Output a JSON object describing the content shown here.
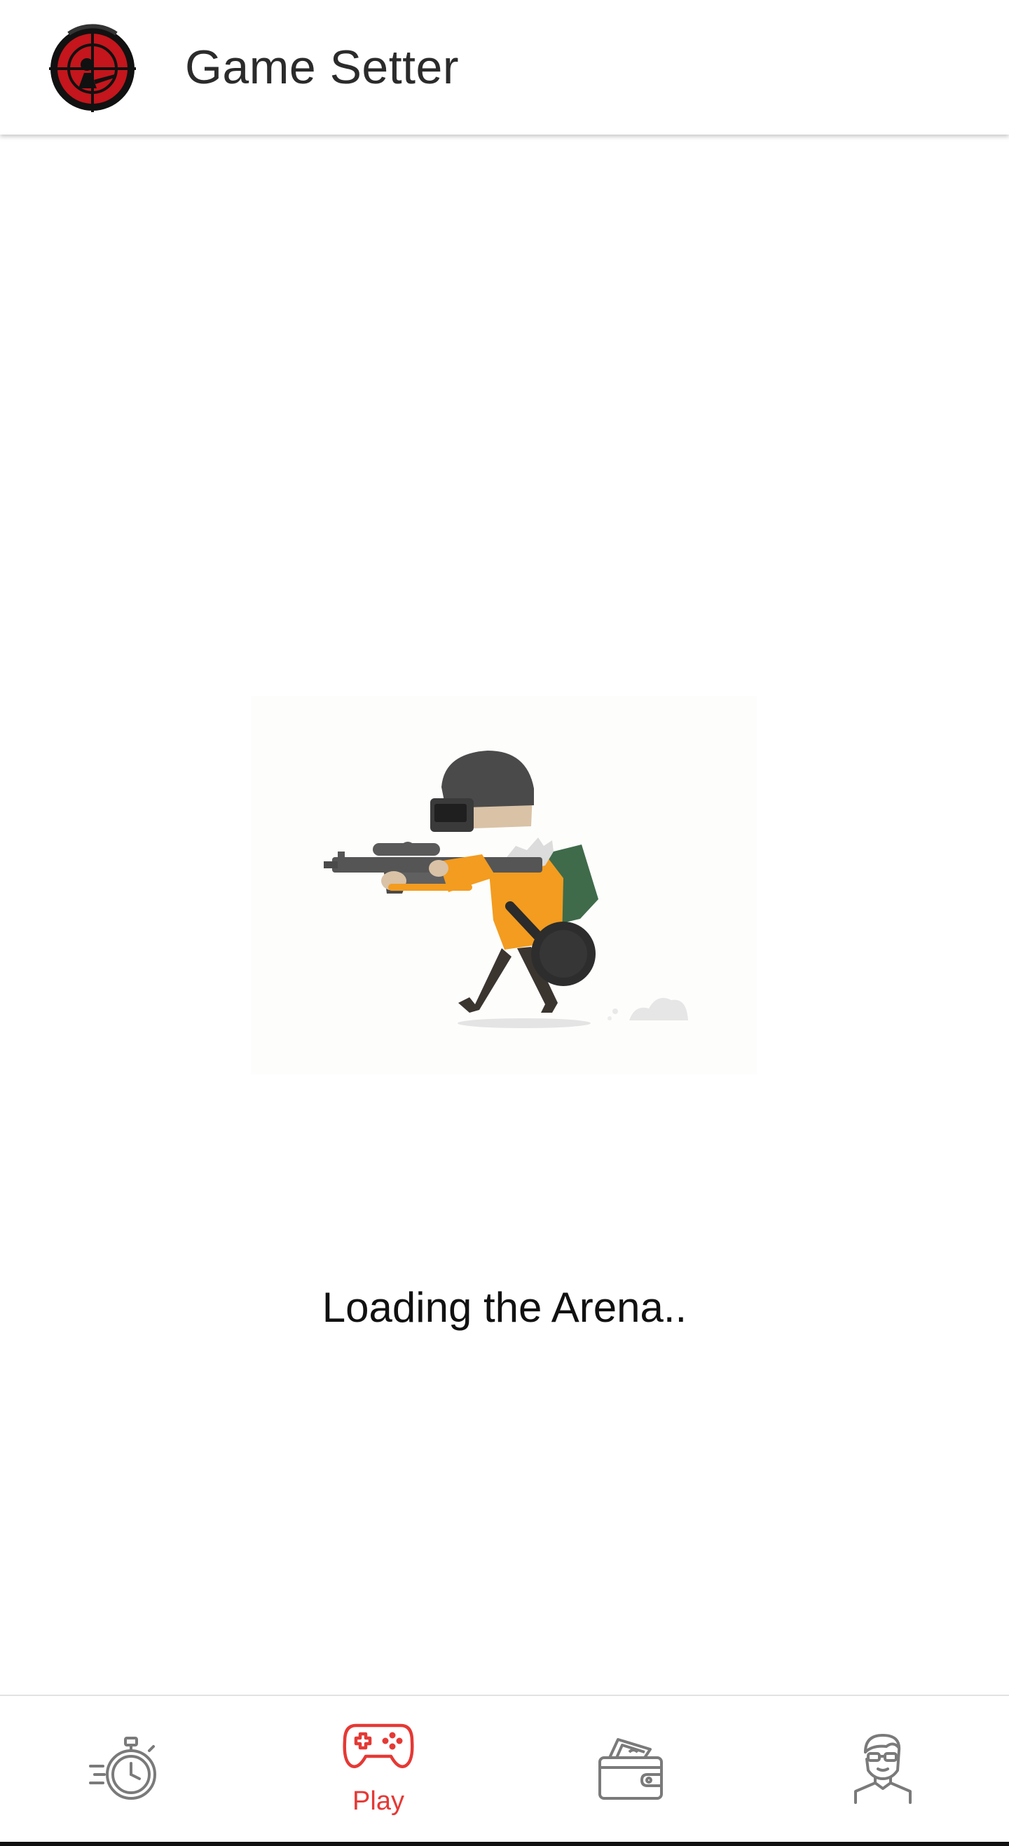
{
  "app": {
    "title": "Game Setter",
    "logo_icon": "sniper-scope-logo-icon"
  },
  "loading": {
    "message": "Loading the Arena..",
    "illustration": "soldier-running-illustration"
  },
  "bottom_nav": {
    "active_color": "#e53935",
    "inactive_color": "#7a7a7a",
    "items": [
      {
        "icon": "stopwatch-icon",
        "label": "",
        "active": false
      },
      {
        "icon": "gamepad-icon",
        "label": "Play",
        "active": true
      },
      {
        "icon": "wallet-icon",
        "label": "",
        "active": false
      },
      {
        "icon": "user-profile-icon",
        "label": "",
        "active": false
      }
    ]
  }
}
